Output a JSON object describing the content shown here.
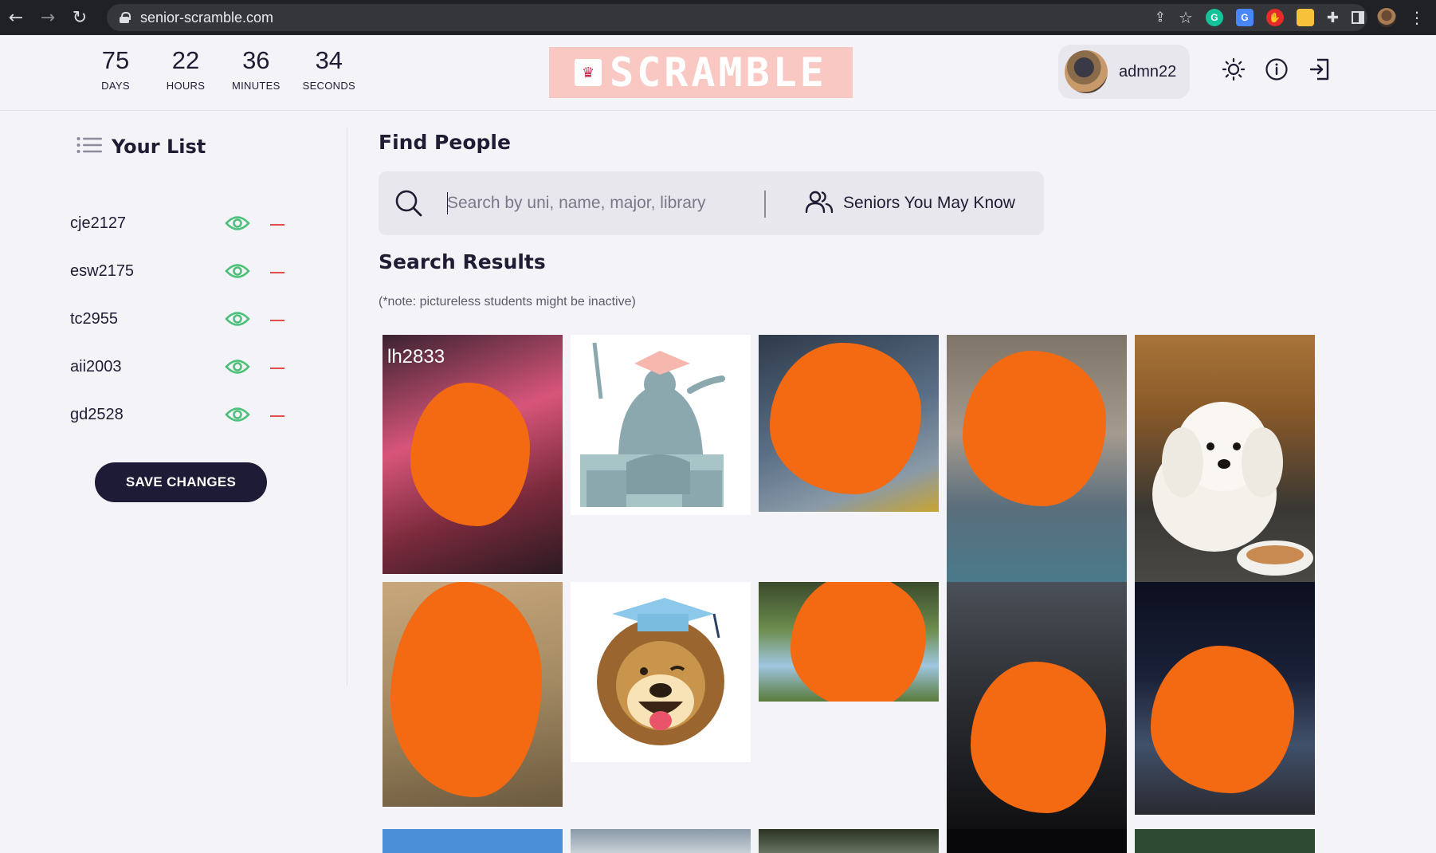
{
  "browser": {
    "url": "senior-scramble.com"
  },
  "countdown": [
    {
      "value": "75",
      "label": "DAYS"
    },
    {
      "value": "22",
      "label": "HOURS"
    },
    {
      "value": "36",
      "label": "MINUTES"
    },
    {
      "value": "34",
      "label": "SECONDS"
    }
  ],
  "logo": {
    "text": "SCRAMBLE"
  },
  "user": {
    "name": "admn22"
  },
  "sidebar": {
    "title": "Your List",
    "items": [
      {
        "name": "cje2127"
      },
      {
        "name": "esw2175"
      },
      {
        "name": "tc2955"
      },
      {
        "name": "aii2003"
      },
      {
        "name": "gd2528"
      }
    ],
    "save_label": "SAVE CHANGES"
  },
  "main": {
    "find_title": "Find People",
    "search_placeholder": "Search by uni, name, major, library",
    "seniors_label": "Seniors You May Know",
    "results_title": "Search Results",
    "note": "(*note: pictureless students might be inactive)",
    "first_card_label": "lh2833"
  },
  "colors": {
    "accent": "#1e1b36",
    "eye": "#4cc07a",
    "remove": "#e64b4b",
    "redaction": "#f36a12",
    "logo_bg": "#f9c8c3"
  }
}
